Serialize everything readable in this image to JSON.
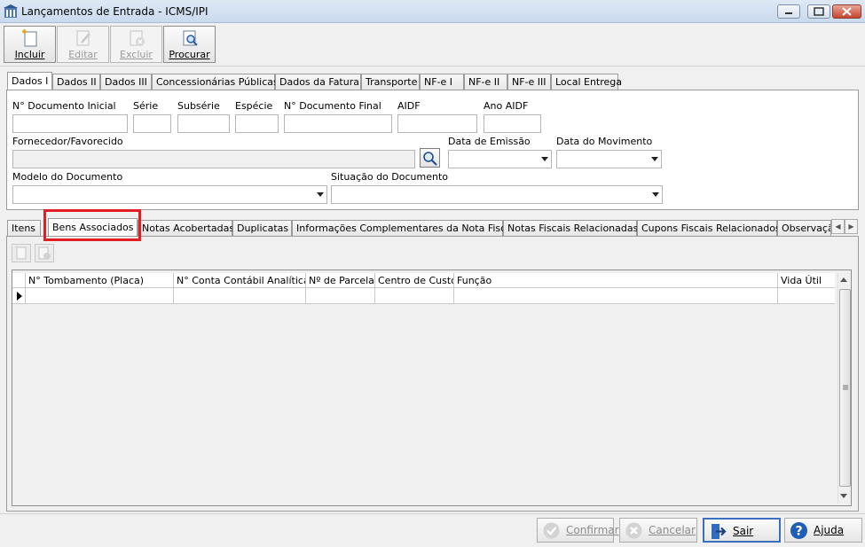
{
  "window": {
    "title": "Lançamentos de Entrada - ICMS/IPI"
  },
  "toolbar": {
    "incluir": "Incluir",
    "editar": "Editar",
    "excluir": "Excluir",
    "procurar": "Procurar"
  },
  "top_tabs": [
    "Dados I",
    "Dados II",
    "Dados III",
    "Concessionárias Públicas",
    "Dados da Fatura",
    "Transporte",
    "NF-e I",
    "NF-e II",
    "NF-e III",
    "Local Entrega"
  ],
  "form": {
    "n_documento_inicial": "N° Documento Inicial",
    "serie": "Série",
    "subserie": "Subsérie",
    "especie": "Espécie",
    "n_documento_final": "N° Documento Final",
    "aidf": "AIDF",
    "ano_aidf": "Ano AIDF",
    "fornecedor": "Fornecedor/Favorecido",
    "data_emissao": "Data de Emissão",
    "data_movimento": "Data do Movimento",
    "modelo_documento": "Modelo do Documento",
    "situacao_documento": "Situação do Documento"
  },
  "bottom_tabs": [
    "Itens",
    "Bens Associados",
    "Notas Acobertadas",
    "Duplicatas",
    "Informações Complementares da Nota Fiscal",
    "Notas Fiscais Relacionadas",
    "Cupons Fiscais Relacionados",
    "Observaçã"
  ],
  "grid": {
    "columns": [
      "N° Tombamento (Placa)",
      "N° Conta Contábil Analítica",
      "Nº de Parcelas",
      "Centro de Custo",
      "Função",
      "Vida Útil"
    ]
  },
  "footer": {
    "confirmar": "Confirmar",
    "cancelar": "Cancelar",
    "sair": "Sair",
    "ajuda": "Ajuda"
  },
  "colors": {
    "highlight": "#e21d23",
    "accent": "#3a6fbf"
  }
}
